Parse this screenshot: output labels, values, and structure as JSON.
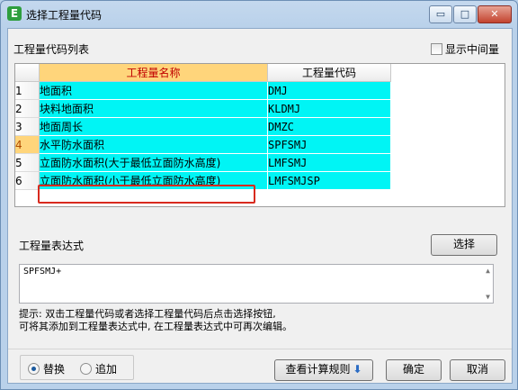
{
  "window": {
    "title": "选择工程量代码",
    "minimize_label": "▭",
    "maximize_label": "□",
    "close_label": "✕"
  },
  "list_label": "工程量代码列表",
  "show_intermediate": {
    "label": "显示中间量",
    "checked": false
  },
  "grid": {
    "headers": [
      "工程量名称",
      "工程量代码"
    ],
    "rows": [
      {
        "num": "1",
        "name": "地面积",
        "code": "DMJ"
      },
      {
        "num": "2",
        "name": "块料地面积",
        "code": "KLDMJ"
      },
      {
        "num": "3",
        "name": "地面周长",
        "code": "DMZC"
      },
      {
        "num": "4",
        "name": "水平防水面积",
        "code": "SPFSMJ"
      },
      {
        "num": "5",
        "name": "立面防水面积(大于最低立面防水高度)",
        "code": "LMFSMJ"
      },
      {
        "num": "6",
        "name": "立面防水面积(小于最低立面防水高度)",
        "code": "LMFSMJSP"
      }
    ],
    "active_row": 4
  },
  "expression_label": "工程量表达式",
  "select_button": "选择",
  "expression_value": "SPFSMJ+",
  "hint_lines": [
    "提示: 双击工程量代码或者选择工程量代码后点击选择按钮,",
    "可将其添加到工程量表达式中, 在工程量表达式中可再次编辑。"
  ],
  "mode": {
    "replace": "替换",
    "append": "追加",
    "selected": "replace"
  },
  "buttons": {
    "view_rules": "查看计算规则",
    "ok": "确定",
    "cancel": "取消"
  }
}
